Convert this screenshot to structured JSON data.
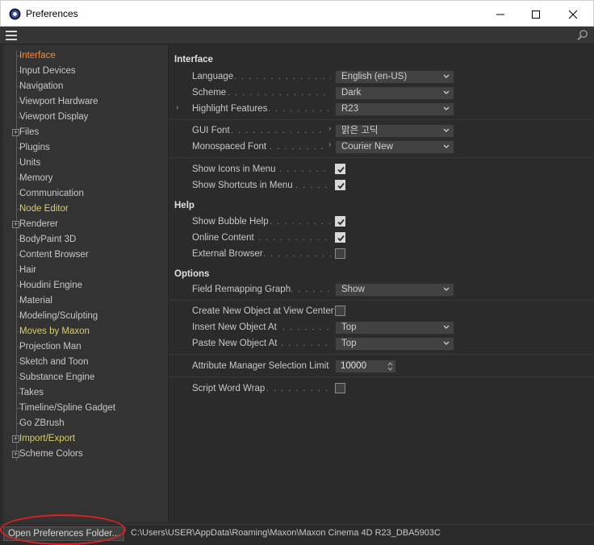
{
  "window": {
    "title": "Preferences",
    "minimize_icon": "minimize-icon",
    "maximize_icon": "maximize-icon",
    "close_icon": "close-icon"
  },
  "sidebar": {
    "items": [
      {
        "label": "Interface",
        "state": "active"
      },
      {
        "label": "Input Devices"
      },
      {
        "label": "Navigation"
      },
      {
        "label": "Viewport Hardware"
      },
      {
        "label": "Viewport Display"
      },
      {
        "label": "Files",
        "expandable": true
      },
      {
        "label": "Plugins"
      },
      {
        "label": "Units"
      },
      {
        "label": "Memory"
      },
      {
        "label": "Communication"
      },
      {
        "label": "Node Editor",
        "state": "highlight"
      },
      {
        "label": "Renderer",
        "expandable": true
      },
      {
        "label": "BodyPaint 3D"
      },
      {
        "label": "Content Browser"
      },
      {
        "label": "Hair"
      },
      {
        "label": "Houdini Engine"
      },
      {
        "label": "Material"
      },
      {
        "label": "Modeling/Sculpting"
      },
      {
        "label": "Moves by Maxon",
        "state": "highlight"
      },
      {
        "label": "Projection Man"
      },
      {
        "label": "Sketch and Toon"
      },
      {
        "label": "Substance Engine"
      },
      {
        "label": "Takes"
      },
      {
        "label": "Timeline/Spline Gadget"
      },
      {
        "label": "Go ZBrush"
      },
      {
        "label": "Import/Export",
        "expandable": true,
        "state": "highlight"
      },
      {
        "label": "Scheme Colors",
        "expandable": true
      }
    ]
  },
  "main": {
    "interface": {
      "title": "Interface",
      "language": {
        "label": "Language",
        "value": "English (en-US)"
      },
      "scheme": {
        "label": "Scheme",
        "value": "Dark"
      },
      "highlight_features": {
        "label": "Highlight Features",
        "value": "R23"
      },
      "gui_font": {
        "label": "GUI Font",
        "value": "맑은 고딕"
      },
      "monospaced_font": {
        "label": "Monospaced Font",
        "value": "Courier New"
      },
      "show_icons_in_menu": {
        "label": "Show Icons in Menu",
        "checked": true
      },
      "show_shortcuts_in_menu": {
        "label": "Show Shortcuts in Menu",
        "checked": true
      }
    },
    "help": {
      "title": "Help",
      "show_bubble_help": {
        "label": "Show Bubble Help",
        "checked": true
      },
      "online_content": {
        "label": "Online Content",
        "checked": true
      },
      "external_browser": {
        "label": "External Browser",
        "checked": false
      }
    },
    "options": {
      "title": "Options",
      "field_remapping_graph": {
        "label": "Field Remapping Graph",
        "value": "Show"
      },
      "create_new_object_at_view_center": {
        "label": "Create New Object at View Center",
        "checked": false
      },
      "insert_new_object_at": {
        "label": "Insert New Object At",
        "value": "Top"
      },
      "paste_new_object_at": {
        "label": "Paste New Object At",
        "value": "Top"
      },
      "attribute_manager_selection_limit": {
        "label": "Attribute Manager Selection Limit",
        "value": "10000"
      },
      "script_word_wrap": {
        "label": "Script Word Wrap",
        "checked": false
      }
    }
  },
  "footer": {
    "open_folder_label": "Open Preferences Folder...",
    "path": "C:\\Users\\USER\\AppData\\Roaming\\Maxon\\Maxon Cinema 4D R23_DBA5903C"
  },
  "colors": {
    "accent_active": "#f08c3c",
    "highlight_yellow": "#d7cf6a",
    "annotation_red": "#e02020"
  }
}
